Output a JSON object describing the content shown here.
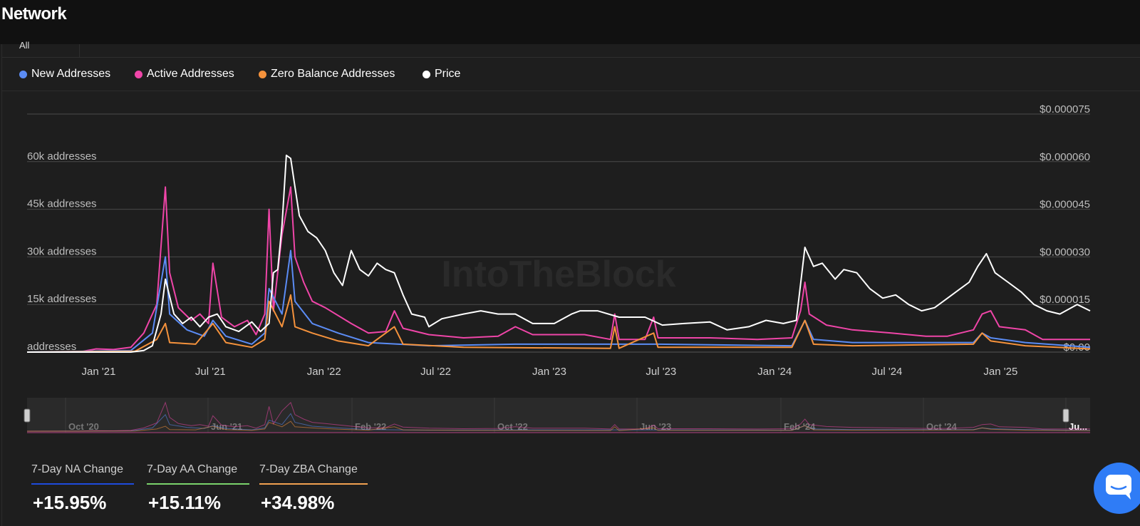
{
  "header": {
    "title": "Network",
    "range_tab": "All"
  },
  "legend": [
    {
      "label": "New Addresses",
      "color": "#5b8cf5"
    },
    {
      "label": "Active Addresses",
      "color": "#ef45a8"
    },
    {
      "label": "Zero Balance Addresses",
      "color": "#f5923c"
    },
    {
      "label": "Price",
      "color": "#ffffff"
    }
  ],
  "watermark": "IntoTheBlock",
  "chart_data": {
    "type": "line",
    "x_start": "2020-09-07",
    "x_end": "2025-05-26",
    "x_ticks": [
      "Jan '21",
      "Jul '21",
      "Jan '22",
      "Jul '22",
      "Jan '23",
      "Jul '23",
      "Jan '24",
      "Jul '24",
      "Jan '25"
    ],
    "y_left": {
      "ticks": [
        "addresses",
        "15k addresses",
        "30k addresses",
        "45k addresses",
        "60k addresses"
      ],
      "range": [
        0,
        75000
      ]
    },
    "y_right": {
      "ticks": [
        "$0.00",
        "$0.000015",
        "$0.000030",
        "$0.000045",
        "$0.000060",
        "$0.000075"
      ],
      "range": [
        0,
        7.5e-05
      ]
    },
    "series": [
      {
        "name": "Active Addresses",
        "axis": "left",
        "color": "#ef45a8",
        "points": [
          [
            "2020-09-07",
            0
          ],
          [
            "2020-11-30",
            0
          ],
          [
            "2020-12-28",
            1000
          ],
          [
            "2021-01-25",
            800
          ],
          [
            "2021-02-22",
            1500
          ],
          [
            "2021-03-15",
            6000
          ],
          [
            "2021-04-05",
            15000
          ],
          [
            "2021-04-19",
            52000
          ],
          [
            "2021-04-26",
            25000
          ],
          [
            "2021-05-10",
            14000
          ],
          [
            "2021-05-31",
            10000
          ],
          [
            "2021-06-14",
            12000
          ],
          [
            "2021-06-28",
            9000
          ],
          [
            "2021-07-05",
            28000
          ],
          [
            "2021-07-19",
            11000
          ],
          [
            "2021-08-09",
            8000
          ],
          [
            "2021-08-30",
            10000
          ],
          [
            "2021-09-13",
            5500
          ],
          [
            "2021-09-27",
            12000
          ],
          [
            "2021-10-04",
            45000
          ],
          [
            "2021-10-11",
            13000
          ],
          [
            "2021-10-25",
            37000
          ],
          [
            "2021-11-08",
            52000
          ],
          [
            "2021-11-15",
            30000
          ],
          [
            "2021-11-29",
            22000
          ],
          [
            "2021-12-13",
            16000
          ],
          [
            "2022-01-03",
            14000
          ],
          [
            "2022-02-14",
            9000
          ],
          [
            "2022-03-14",
            6000
          ],
          [
            "2022-04-11",
            6500
          ],
          [
            "2022-04-25",
            13000
          ],
          [
            "2022-05-09",
            7500
          ],
          [
            "2022-06-20",
            5500
          ],
          [
            "2022-08-15",
            4500
          ],
          [
            "2022-10-10",
            5000
          ],
          [
            "2022-11-07",
            8000
          ],
          [
            "2022-12-05",
            5500
          ],
          [
            "2023-02-27",
            5500
          ],
          [
            "2023-04-10",
            4000
          ],
          [
            "2023-04-17",
            12000
          ],
          [
            "2023-04-24",
            4000
          ],
          [
            "2023-06-05",
            4000
          ],
          [
            "2023-06-19",
            11000
          ],
          [
            "2023-06-26",
            4500
          ],
          [
            "2023-09-18",
            4500
          ],
          [
            "2023-12-04",
            4000
          ],
          [
            "2024-01-29",
            4500
          ],
          [
            "2024-02-12",
            13000
          ],
          [
            "2024-02-19",
            22000
          ],
          [
            "2024-02-26",
            12000
          ],
          [
            "2024-03-25",
            8500
          ],
          [
            "2024-05-06",
            7000
          ],
          [
            "2024-07-08",
            6000
          ],
          [
            "2024-09-02",
            5000
          ],
          [
            "2024-10-07",
            5000
          ],
          [
            "2024-11-18",
            7000
          ],
          [
            "2024-12-02",
            12000
          ],
          [
            "2024-12-16",
            13000
          ],
          [
            "2024-12-30",
            8000
          ],
          [
            "2025-02-10",
            7000
          ],
          [
            "2025-03-10",
            4000
          ],
          [
            "2025-05-26",
            4000
          ]
        ]
      },
      {
        "name": "New Addresses",
        "axis": "left",
        "color": "#5b8cf5",
        "points": [
          [
            "2020-09-07",
            0
          ],
          [
            "2021-02-22",
            500
          ],
          [
            "2021-03-29",
            6000
          ],
          [
            "2021-04-19",
            30000
          ],
          [
            "2021-04-26",
            12000
          ],
          [
            "2021-05-24",
            7000
          ],
          [
            "2021-06-21",
            5000
          ],
          [
            "2021-07-05",
            10000
          ],
          [
            "2021-07-26",
            5000
          ],
          [
            "2021-09-06",
            2500
          ],
          [
            "2021-09-27",
            6000
          ],
          [
            "2021-10-04",
            20000
          ],
          [
            "2021-10-25",
            12000
          ],
          [
            "2021-11-08",
            32000
          ],
          [
            "2021-11-15",
            16000
          ],
          [
            "2021-12-13",
            9000
          ],
          [
            "2022-01-24",
            6000
          ],
          [
            "2022-03-14",
            3000
          ],
          [
            "2022-06-20",
            2000
          ],
          [
            "2022-11-07",
            2500
          ],
          [
            "2023-06-26",
            2500
          ],
          [
            "2024-01-29",
            2000
          ],
          [
            "2024-02-19",
            10000
          ],
          [
            "2024-03-04",
            4000
          ],
          [
            "2024-05-06",
            3000
          ],
          [
            "2024-11-18",
            3000
          ],
          [
            "2024-12-02",
            6000
          ],
          [
            "2024-12-16",
            4500
          ],
          [
            "2025-02-10",
            3000
          ],
          [
            "2025-05-26",
            1500
          ]
        ]
      },
      {
        "name": "Zero Balance Addresses",
        "axis": "left",
        "color": "#f5923c",
        "points": [
          [
            "2020-09-07",
            0
          ],
          [
            "2021-03-01",
            300
          ],
          [
            "2021-04-05",
            4000
          ],
          [
            "2021-04-19",
            9000
          ],
          [
            "2021-04-26",
            3000
          ],
          [
            "2021-06-07",
            2500
          ],
          [
            "2021-07-05",
            9000
          ],
          [
            "2021-07-26",
            3000
          ],
          [
            "2021-09-06",
            1500
          ],
          [
            "2021-09-27",
            4000
          ],
          [
            "2021-10-04",
            16000
          ],
          [
            "2021-10-25",
            8000
          ],
          [
            "2021-11-08",
            18000
          ],
          [
            "2021-11-15",
            8000
          ],
          [
            "2021-12-13",
            6000
          ],
          [
            "2022-01-24",
            3500
          ],
          [
            "2022-03-14",
            2000
          ],
          [
            "2022-04-25",
            8000
          ],
          [
            "2022-05-09",
            2500
          ],
          [
            "2022-08-15",
            1500
          ],
          [
            "2023-04-10",
            1200
          ],
          [
            "2023-04-17",
            8000
          ],
          [
            "2023-04-24",
            1200
          ],
          [
            "2023-06-19",
            6000
          ],
          [
            "2023-06-26",
            1500
          ],
          [
            "2024-01-29",
            1500
          ],
          [
            "2024-02-19",
            10000
          ],
          [
            "2024-03-04",
            2500
          ],
          [
            "2024-05-06",
            2000
          ],
          [
            "2024-11-18",
            2500
          ],
          [
            "2024-12-02",
            6000
          ],
          [
            "2024-12-16",
            3500
          ],
          [
            "2025-02-10",
            2000
          ],
          [
            "2025-05-26",
            1000
          ]
        ]
      },
      {
        "name": "Price",
        "axis": "right",
        "color": "#ffffff",
        "points": [
          [
            "2020-09-07",
            0
          ],
          [
            "2021-02-22",
            0
          ],
          [
            "2021-03-15",
            5e-07
          ],
          [
            "2021-03-29",
            2e-06
          ],
          [
            "2021-04-12",
            1.2e-05
          ],
          [
            "2021-04-19",
            2.3e-05
          ],
          [
            "2021-05-03",
            1.2e-05
          ],
          [
            "2021-05-17",
            9e-06
          ],
          [
            "2021-05-31",
            1.1e-05
          ],
          [
            "2021-06-14",
            8e-06
          ],
          [
            "2021-06-28",
            1.1e-05
          ],
          [
            "2021-07-12",
            1.2e-05
          ],
          [
            "2021-07-26",
            8e-06
          ],
          [
            "2021-08-16",
            6.5e-06
          ],
          [
            "2021-09-06",
            9.5e-06
          ],
          [
            "2021-09-20",
            6.5e-06
          ],
          [
            "2021-10-04",
            9e-06
          ],
          [
            "2021-10-11",
            2.5e-05
          ],
          [
            "2021-10-18",
            2.6e-05
          ],
          [
            "2021-10-25",
            4e-05
          ],
          [
            "2021-11-01",
            6.2e-05
          ],
          [
            "2021-11-08",
            6.1e-05
          ],
          [
            "2021-11-15",
            5.2e-05
          ],
          [
            "2021-11-22",
            4.3e-05
          ],
          [
            "2021-12-06",
            3.8e-05
          ],
          [
            "2021-12-20",
            3.6e-05
          ],
          [
            "2022-01-03",
            3.2e-05
          ],
          [
            "2022-01-17",
            2.5e-05
          ],
          [
            "2022-01-31",
            2.1e-05
          ],
          [
            "2022-02-14",
            3.2e-05
          ],
          [
            "2022-02-28",
            2.6e-05
          ],
          [
            "2022-03-14",
            2.4e-05
          ],
          [
            "2022-03-28",
            2.8e-05
          ],
          [
            "2022-04-11",
            2.6e-05
          ],
          [
            "2022-04-25",
            2.5e-05
          ],
          [
            "2022-05-09",
            1.8e-05
          ],
          [
            "2022-05-23",
            1.2e-05
          ],
          [
            "2022-06-13",
            1.1e-05
          ],
          [
            "2022-06-20",
            8e-06
          ],
          [
            "2022-07-11",
            1.05e-05
          ],
          [
            "2022-08-15",
            1.2e-05
          ],
          [
            "2022-09-12",
            1.3e-05
          ],
          [
            "2022-10-10",
            1.2e-05
          ],
          [
            "2022-11-07",
            1.2e-05
          ],
          [
            "2022-12-05",
            9e-06
          ],
          [
            "2023-01-09",
            9e-06
          ],
          [
            "2023-02-06",
            1.2e-05
          ],
          [
            "2023-02-20",
            1.3e-05
          ],
          [
            "2023-03-20",
            1.3e-05
          ],
          [
            "2023-04-24",
            1.1e-05
          ],
          [
            "2023-06-05",
            1.1e-05
          ],
          [
            "2023-07-03",
            8.5e-06
          ],
          [
            "2023-08-07",
            9e-06
          ],
          [
            "2023-09-18",
            9.5e-06
          ],
          [
            "2023-10-16",
            7e-06
          ],
          [
            "2023-11-20",
            8e-06
          ],
          [
            "2023-12-18",
            1e-05
          ],
          [
            "2024-01-15",
            9e-06
          ],
          [
            "2024-02-05",
            1e-05
          ],
          [
            "2024-02-19",
            3.3e-05
          ],
          [
            "2024-03-04",
            2.7e-05
          ],
          [
            "2024-03-18",
            2.8e-05
          ],
          [
            "2024-04-08",
            2.3e-05
          ],
          [
            "2024-04-22",
            2.6e-05
          ],
          [
            "2024-05-13",
            2.5e-05
          ],
          [
            "2024-06-03",
            2e-05
          ],
          [
            "2024-06-24",
            1.7e-05
          ],
          [
            "2024-07-15",
            1.8e-05
          ],
          [
            "2024-08-05",
            1.5e-05
          ],
          [
            "2024-08-26",
            1.3e-05
          ],
          [
            "2024-09-16",
            1.4e-05
          ],
          [
            "2024-10-07",
            1.7e-05
          ],
          [
            "2024-10-28",
            2e-05
          ],
          [
            "2024-11-11",
            2.2e-05
          ],
          [
            "2024-11-25",
            2.7e-05
          ],
          [
            "2024-12-09",
            3.1e-05
          ],
          [
            "2024-12-23",
            2.5e-05
          ],
          [
            "2025-01-13",
            2.2e-05
          ],
          [
            "2025-02-03",
            1.9e-05
          ],
          [
            "2025-02-24",
            1.5e-05
          ],
          [
            "2025-03-17",
            1.3e-05
          ],
          [
            "2025-04-07",
            1.2e-05
          ],
          [
            "2025-05-05",
            1.5e-05
          ],
          [
            "2025-05-26",
            1.3e-05
          ]
        ]
      }
    ]
  },
  "navigator": {
    "labels": [
      "Oct '20",
      "Jun '21",
      "Feb '22",
      "Oct '22",
      "Jun '23",
      "Feb '24",
      "Oct '24",
      "Ju..."
    ]
  },
  "stats": [
    {
      "label": "7-Day NA Change",
      "value": "+15.95%",
      "color": "#1e4bdc"
    },
    {
      "label": "7-Day AA Change",
      "value": "+15.11%",
      "color": "#7ad36b"
    },
    {
      "label": "7-Day ZBA Change",
      "value": "+34.98%",
      "color": "#f0a050"
    }
  ]
}
